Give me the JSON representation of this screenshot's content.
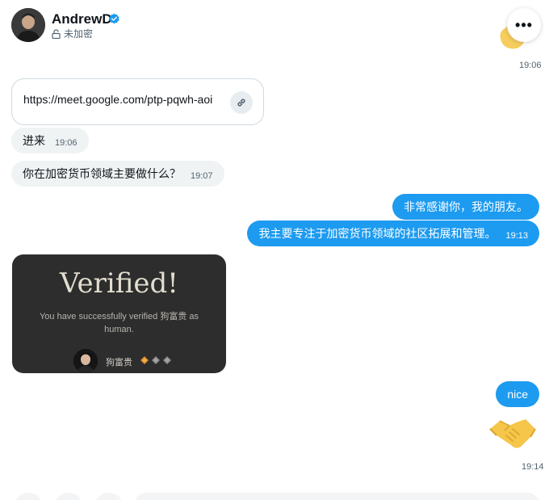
{
  "header": {
    "contact_name": "AndrewD",
    "encryption_status": "未加密",
    "more_label": "•••"
  },
  "messages": {
    "wave_time": "19:06",
    "link_url": "https://meet.google.com/ptp-pqwh-aoi",
    "msg_come_in": "进来",
    "msg_come_in_time": "19:06",
    "msg_question": "你在加密货币领域主要做什么？",
    "msg_question_time": "19:07",
    "msg_thanks": "非常感谢你，我的朋友。",
    "msg_focus": "我主要专注于加密货币领域的社区拓展和管理。",
    "msg_focus_time": "19:13",
    "msg_nice": "nice",
    "handshake_time": "19:14"
  },
  "verified_card": {
    "title": "Verified!",
    "description": "You have successfully verified 狗富贵 as human.",
    "user_name": "狗富贵"
  },
  "colors": {
    "accent": "#1d9bf0",
    "incoming_bubble": "#eff3f4",
    "card_bg": "#2d2d2d",
    "badge_gold": "#d98a2b",
    "badge_gray": "#8a8a8a"
  }
}
